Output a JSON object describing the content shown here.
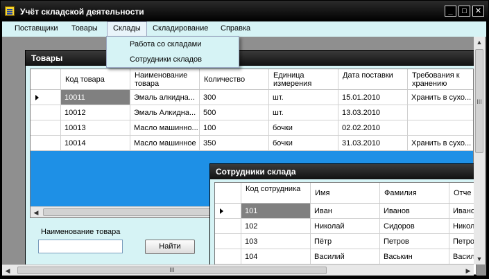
{
  "window": {
    "title": "Учёт складской деятельности"
  },
  "menu": {
    "items": [
      "Поставщики",
      "Товары",
      "Склады",
      "Складирование",
      "Справка"
    ],
    "active": "Склады",
    "dropdown": [
      "Работа со складами",
      "Сотрудники складов"
    ]
  },
  "goods": {
    "title": "Товары",
    "columns": [
      "Код товара",
      "Наименование товара",
      "Количество",
      "Единица измерения",
      "Дата поставки",
      "Требования к хранению"
    ],
    "rows": [
      [
        "10011",
        "Эмаль алкидна...",
        "300",
        "шт.",
        "15.01.2010",
        "Хранить в сухо..."
      ],
      [
        "10012",
        "Эмаль Алкидна...",
        "500",
        "шт.",
        "13.03.2010",
        ""
      ],
      [
        "10013",
        "Масло машинно...",
        "100",
        "бочки",
        "02.02.2010",
        ""
      ],
      [
        "10014",
        "Масло машинное",
        "350",
        "бочки",
        "31.03.2010",
        "Хранить в сухо..."
      ]
    ],
    "search_label": "Наименование товара",
    "search_value": "",
    "find_button": "Найти"
  },
  "staff": {
    "title": "Сотрудники склада",
    "columns": [
      "Код сотрудника",
      "Имя",
      "Фамилия",
      "Отче"
    ],
    "rows": [
      [
        "101",
        "Иван",
        "Иванов",
        "Ивано"
      ],
      [
        "102",
        "Николай",
        "Сидоров",
        "Никол"
      ],
      [
        "103",
        "Пётр",
        "Петров",
        "Петро"
      ],
      [
        "104",
        "Василий",
        "Васькин",
        "Васил"
      ]
    ]
  },
  "scroll": {
    "grip": "III"
  },
  "colors": {
    "accent_blue": "#1e90e6",
    "panel_bg": "#d6f3f5",
    "selection": "#808080"
  }
}
